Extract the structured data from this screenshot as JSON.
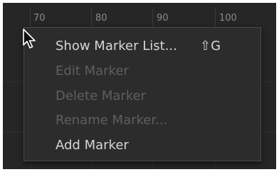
{
  "ruler": {
    "ticks": [
      "70",
      "80",
      "90",
      "100"
    ]
  },
  "context_menu": {
    "items": [
      {
        "label": "Show Marker List...",
        "enabled": true,
        "shortcut": "⇧G"
      },
      {
        "label": "Edit Marker",
        "enabled": false
      },
      {
        "label": "Delete Marker",
        "enabled": false
      },
      {
        "label": "Rename Marker...",
        "enabled": false
      },
      {
        "label": "Add Marker",
        "enabled": true
      }
    ]
  },
  "cursor": {
    "icon": "arrow-pointer-icon"
  },
  "colors": {
    "background": "#262626",
    "menu_background": "#2c2c2c",
    "text_enabled": "#d6d6d6",
    "text_disabled": "#5f5f5f"
  }
}
